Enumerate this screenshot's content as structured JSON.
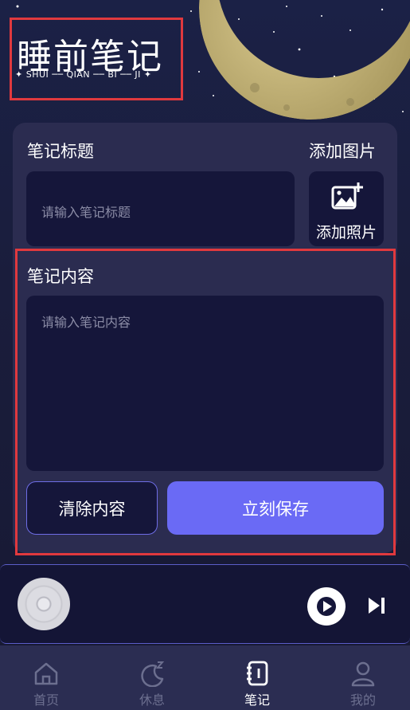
{
  "brand": {
    "title": "睡前笔记",
    "subtitle": "✦ SHUI ── QIAN ── BI ── JI ✦"
  },
  "form": {
    "title_label": "笔记标题",
    "title_placeholder": "请输入笔记标题",
    "add_image_label": "添加图片",
    "add_photo_caption": "添加照片",
    "content_label": "笔记内容",
    "content_placeholder": "请输入笔记内容",
    "clear_button": "清除内容",
    "save_button": "立刻保存"
  },
  "player": {
    "disc_icon": "music-disc-icon",
    "play_icon": "play-icon",
    "next_icon": "skip-next-icon"
  },
  "tabs": [
    {
      "label": "首页",
      "icon": "home-icon",
      "active": false
    },
    {
      "label": "休息",
      "icon": "moon-sleep-icon",
      "active": false
    },
    {
      "label": "笔记",
      "icon": "notebook-icon",
      "active": true
    },
    {
      "label": "我的",
      "icon": "user-icon",
      "active": false
    }
  ],
  "colors": {
    "background": "#1a1d3c",
    "card": "#2b2c50",
    "input": "#15163a",
    "accent": "#6a6af5",
    "highlight_frame": "#e0393e",
    "moon": "#c9b77a"
  }
}
